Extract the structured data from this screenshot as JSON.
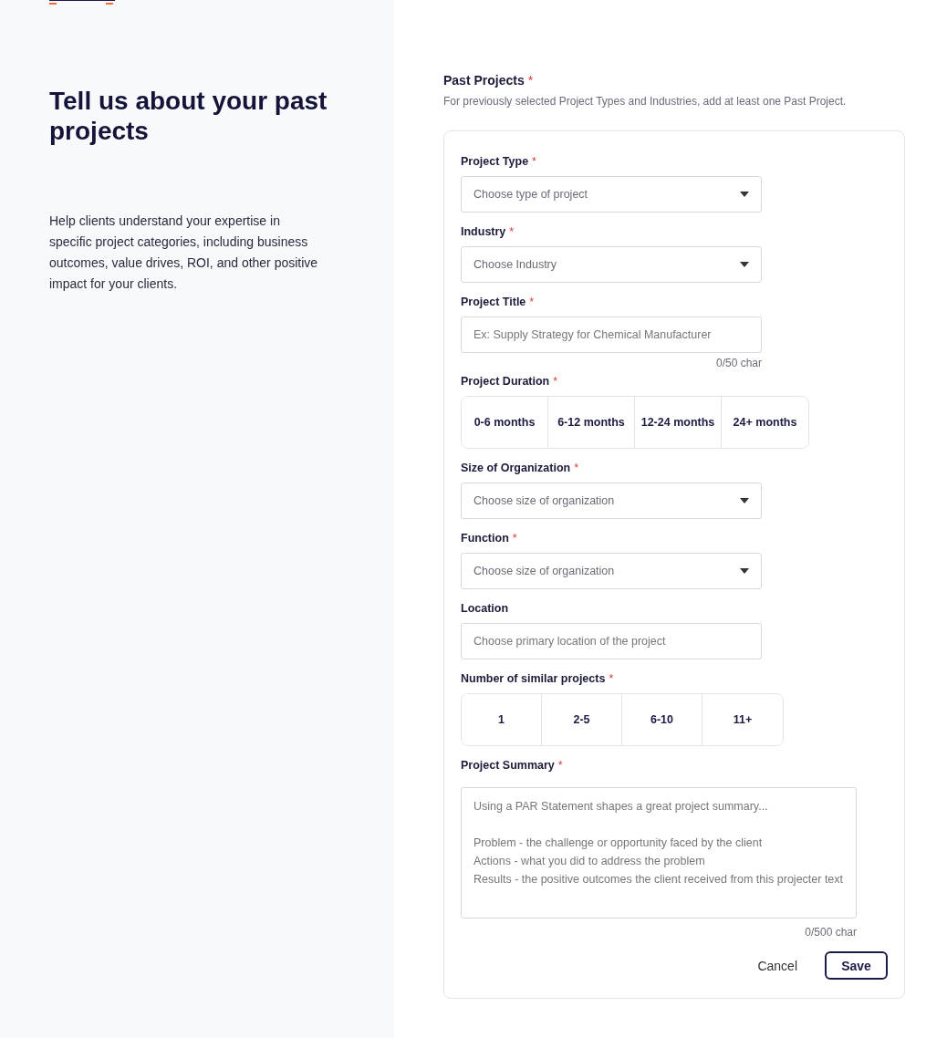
{
  "aside": {
    "title": "Tell us about your past projects",
    "description": "Help clients understand your expertise in specific project categories, including business outcomes, value drives, ROI, and other positive impact for your clients."
  },
  "section": {
    "title": "Past Projects",
    "required_mark": "*",
    "description": "For previously selected Project Types and Industries, add at least one Past Project."
  },
  "fields": [
    {
      "kind": "select",
      "label": "Project Type",
      "required_mark": "*",
      "placeholder": "Choose type of project"
    },
    {
      "kind": "select",
      "label": "Industry",
      "required_mark": "*",
      "placeholder": "Choose Industry"
    },
    {
      "kind": "text",
      "label": "Project Title",
      "required_mark": "*",
      "placeholder": "Ex: Supply Strategy for Chemical Manufacturer",
      "counter": "0/50 char"
    },
    {
      "kind": "segmented",
      "label": "Project Duration",
      "required_mark": "*",
      "options": [
        {
          "label": "0-6 months",
          "selected": false
        },
        {
          "label": "6-12 months",
          "selected": false
        },
        {
          "label": "12-24 months",
          "selected": false
        },
        {
          "label": "24+ months",
          "selected": false
        }
      ]
    },
    {
      "kind": "select",
      "label": "Size of Organization",
      "required_mark": "*",
      "placeholder": "Choose size of organization"
    },
    {
      "kind": "select",
      "label": "Function",
      "required_mark": "*",
      "placeholder": "Choose size of organization"
    },
    {
      "kind": "text",
      "label": "Location",
      "placeholder": "Choose primary location of the project"
    },
    {
      "kind": "segmented",
      "label": "Number of similar projects",
      "required_mark": "*",
      "options": [
        {
          "label": "1",
          "selected": false
        },
        {
          "label": "2-5",
          "selected": false
        },
        {
          "label": "6-10",
          "selected": false
        },
        {
          "label": "11+",
          "selected": false
        }
      ]
    },
    {
      "kind": "textarea",
      "label": "Project Summary",
      "required_mark": "*",
      "placeholder": "Using a PAR Statement shapes a great project summary...\n\nProblem - the challenge or opportunity faced by the client\nActions - what you did to address the problem\nResults - the positive outcomes the client received from this projecter text",
      "counter": "0/500 char"
    }
  ],
  "buttons": {
    "cancel": "Cancel",
    "save": "Save"
  }
}
